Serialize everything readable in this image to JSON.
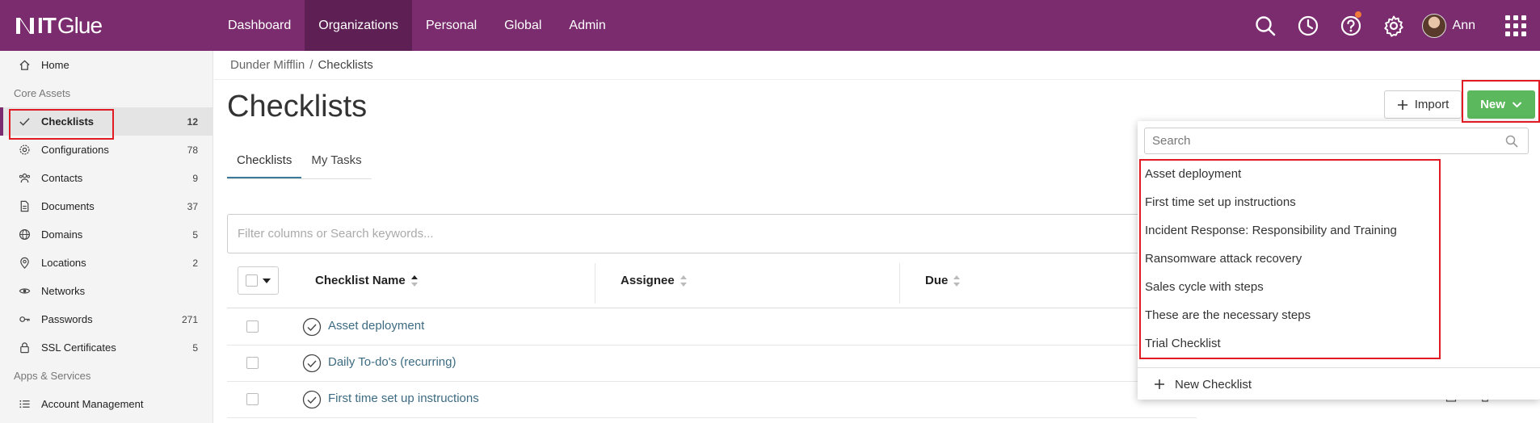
{
  "header": {
    "logo_text_bold": "IT",
    "logo_text": "Glue",
    "nav": [
      {
        "label": "Dashboard"
      },
      {
        "label": "Organizations"
      },
      {
        "label": "Personal"
      },
      {
        "label": "Global"
      },
      {
        "label": "Admin"
      }
    ],
    "active_nav": "Organizations",
    "user_name": "Ann",
    "colors": {
      "bar": "#7a2c6e",
      "active": "#5e1f55"
    }
  },
  "sidebar": {
    "home": "Home",
    "section_core": "Core Assets",
    "items": [
      {
        "label": "Checklists",
        "count": "12",
        "icon": "check-icon"
      },
      {
        "label": "Configurations",
        "count": "78",
        "icon": "gear-icon"
      },
      {
        "label": "Contacts",
        "count": "9",
        "icon": "people-icon"
      },
      {
        "label": "Documents",
        "count": "37",
        "icon": "document-icon"
      },
      {
        "label": "Domains",
        "count": "5",
        "icon": "globe-icon"
      },
      {
        "label": "Locations",
        "count": "2",
        "icon": "pin-icon"
      },
      {
        "label": "Networks",
        "count": "",
        "icon": "network-icon"
      },
      {
        "label": "Passwords",
        "count": "271",
        "icon": "key-icon"
      },
      {
        "label": "SSL Certificates",
        "count": "5",
        "icon": "lock-icon"
      }
    ],
    "section_apps": "Apps & Services",
    "apps_items": [
      {
        "label": "Account Management",
        "icon": "list-icon"
      }
    ]
  },
  "breadcrumb": {
    "org": "Dunder Mifflin",
    "sep": "/",
    "current": "Checklists"
  },
  "page": {
    "title": "Checklists",
    "import_label": "Import",
    "new_label": "New",
    "tabs": [
      {
        "label": "Checklists"
      },
      {
        "label": "My Tasks"
      }
    ],
    "filter_placeholder": "Filter columns or Search keywords..."
  },
  "table": {
    "columns": [
      "Checklist Name",
      "Assignee",
      "Due"
    ],
    "rows": [
      {
        "name": "Asset deployment"
      },
      {
        "name": "Daily To-do's (recurring)"
      },
      {
        "name": "First time set up instructions"
      }
    ]
  },
  "dropdown": {
    "search_placeholder": "Search",
    "items": [
      "Asset deployment",
      "First time set up instructions",
      "Incident Response: Responsibility and Training",
      "Ransomware attack recovery",
      "Sales cycle with steps",
      "These are the necessary steps",
      "Trial Checklist"
    ],
    "new_checklist": "New Checklist"
  }
}
